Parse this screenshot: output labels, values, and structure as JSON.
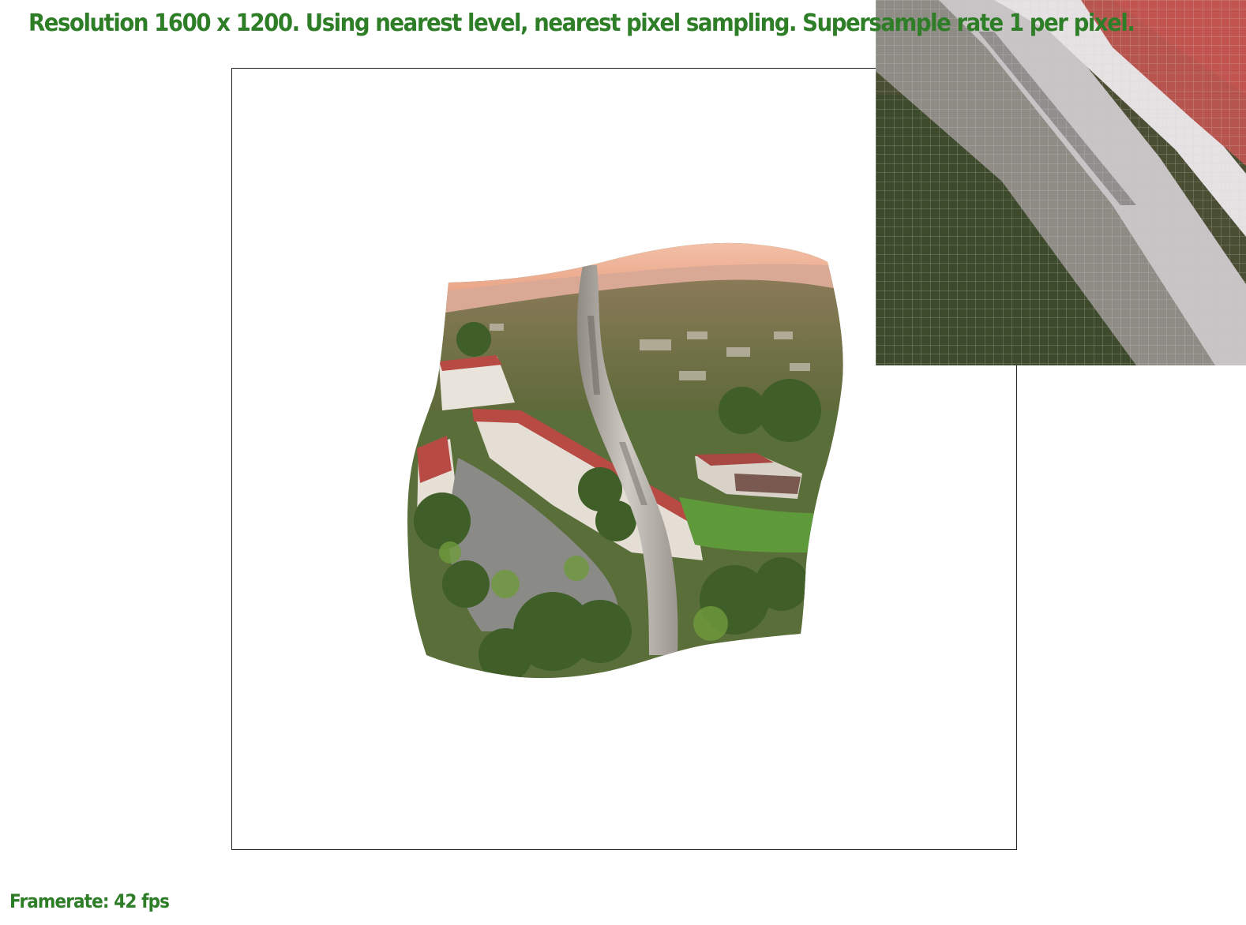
{
  "status_text": "Resolution 1600 x 1200. Using nearest level, nearest pixel sampling. Supersample rate 1 per pixel.",
  "framerate_text": "Framerate: 42 fps",
  "colors": {
    "status_text": "#2e7d27",
    "frame_border": "#222222",
    "zoom_grid": "#d0d0d0",
    "sky": "#f2b8a0",
    "foliage": "#4e6b34",
    "roof_red": "#b84a44",
    "tower_stone": "#b9b4ae"
  },
  "icons": {
    "texture": "warped-campus-photo",
    "zoom": "pixel-zoom-grid"
  }
}
